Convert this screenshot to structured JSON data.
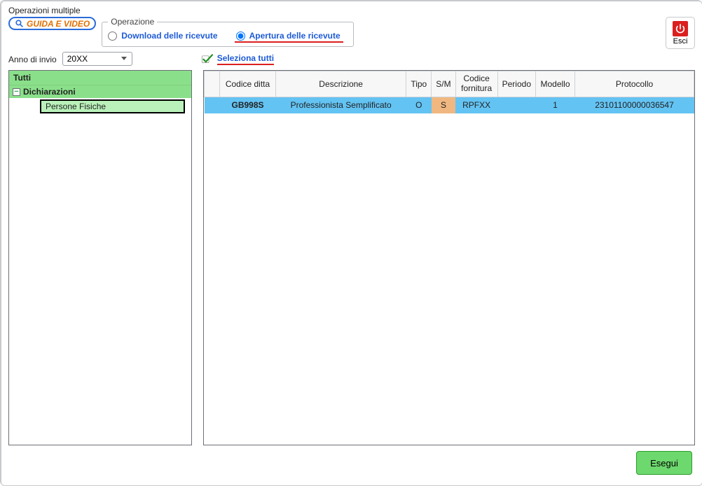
{
  "window_title": "Operazioni multiple",
  "guida_btn": "GUIDA E VIDEO",
  "operazione": {
    "legend": "Operazione",
    "download_label": "Download delle ricevute",
    "apertura_label": "Apertura delle ricevute"
  },
  "esci_label": "Esci",
  "anno": {
    "label": "Anno di invio",
    "value": "20XX"
  },
  "seleziona_tutti_label": "Seleziona tutti",
  "tree": {
    "all_label": "Tutti",
    "node1_label": "Dichiarazioni",
    "leaf1_label": "Persone Fisiche"
  },
  "grid": {
    "headers": {
      "codice_ditta": "Codice ditta",
      "descrizione": "Descrizione",
      "tipo": "Tipo",
      "sm": "S/M",
      "codice_fornitura": "Codice\nfornitura",
      "periodo": "Periodo",
      "modello": "Modello",
      "protocollo": "Protocollo"
    },
    "rows": [
      {
        "codice_ditta": "GB998S",
        "descrizione": "Professionista Semplificato",
        "tipo": "O",
        "sm": "S",
        "codice_fornitura": "RPFXX",
        "periodo": "",
        "modello": "1",
        "protocollo": "23101100000036547"
      }
    ]
  },
  "esegui_label": "Esegui"
}
